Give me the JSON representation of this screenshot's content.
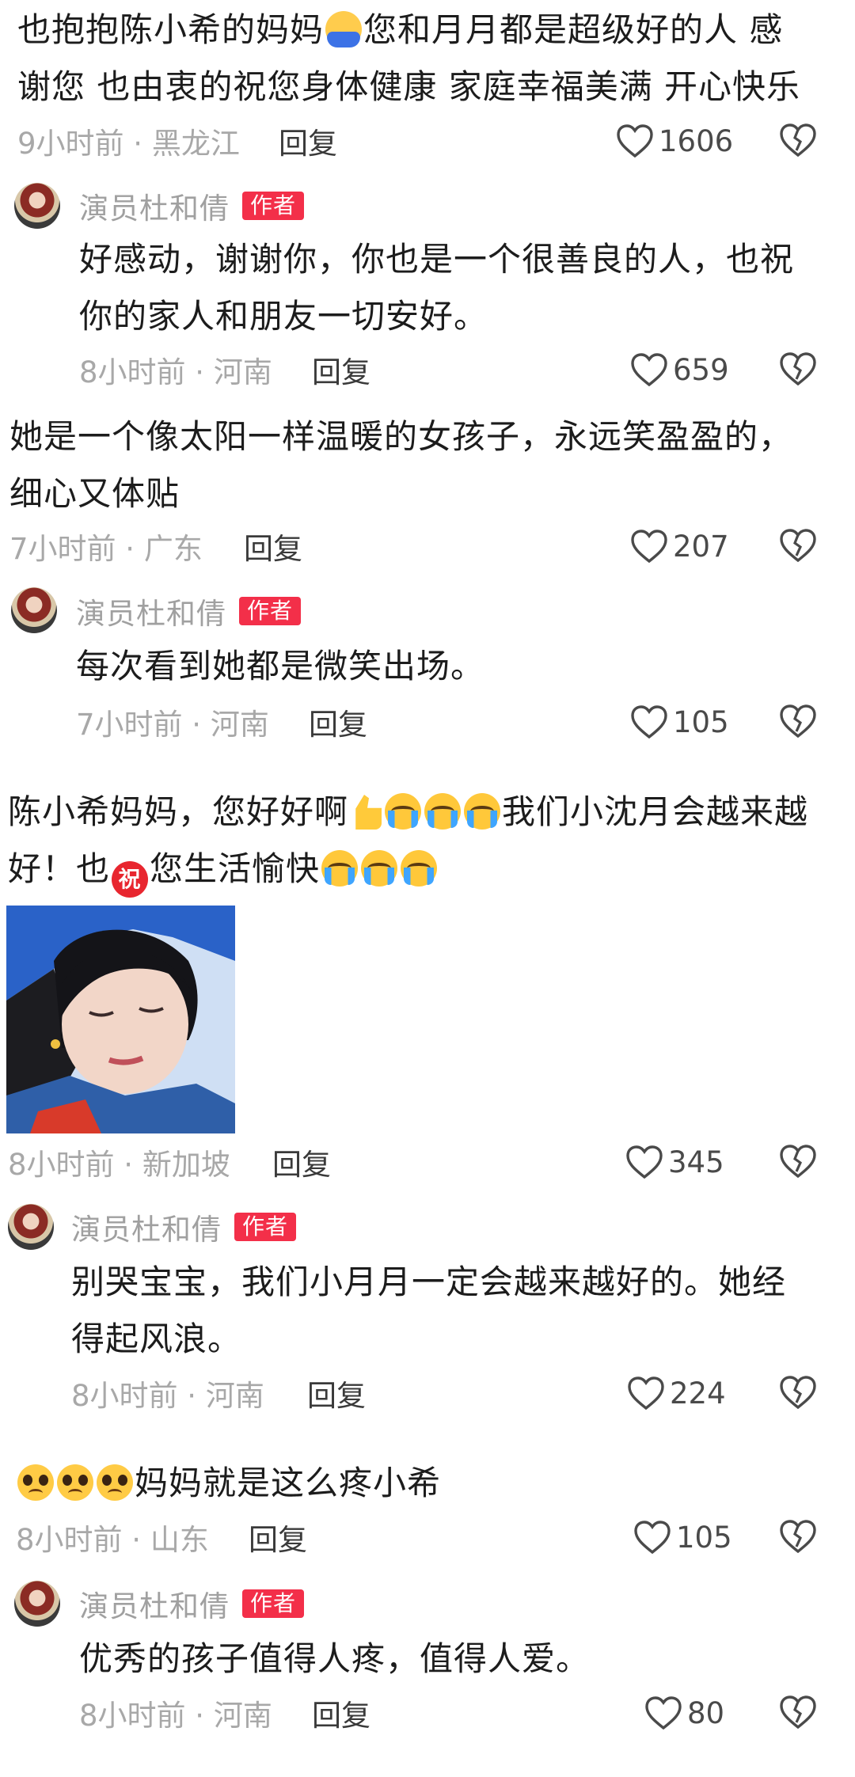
{
  "comments": [
    {
      "text": "也抱抱陈小希的妈妈",
      "text2": "您和月月都是超级好的人 感谢您 也由衷的祝您身体健康 家庭幸福美满 开心快乐",
      "time_location": "9小时前 · 黑龙江",
      "reply_label": "回复",
      "likes": "1606",
      "reply": {
        "author": "演员杜和倩",
        "badge": "作者",
        "text": "好感动，谢谢你，你也是一个很善良的人，也祝你的家人和朋友一切安好。",
        "time_location": "8小时前 · 河南",
        "reply_label": "回复",
        "likes": "659"
      }
    },
    {
      "text": "她是一个像太阳一样温暖的女孩子，永远笑盈盈的，细心又体贴",
      "time_location": "7小时前 · 广东",
      "reply_label": "回复",
      "likes": "207",
      "reply": {
        "author": "演员杜和倩",
        "badge": "作者",
        "text": "每次看到她都是微笑出场。",
        "time_location": "7小时前 · 河南",
        "reply_label": "回复",
        "likes": "105"
      }
    },
    {
      "text_a": "陈小希妈妈，您好好啊",
      "text_b": "我们小沈月会越来越好！也",
      "text_c": "您生活愉快",
      "zhu": "祝",
      "time_location": "8小时前 · 新加坡",
      "reply_label": "回复",
      "likes": "345",
      "reply": {
        "author": "演员杜和倩",
        "badge": "作者",
        "text": "别哭宝宝，我们小月月一定会越来越好的。她经得起风浪。",
        "time_location": "8小时前 · 河南",
        "reply_label": "回复",
        "likes": "224"
      }
    },
    {
      "text": "妈妈就是这么疼小希",
      "time_location": "8小时前 · 山东",
      "reply_label": "回复",
      "likes": "105",
      "reply": {
        "author": "演员杜和倩",
        "badge": "作者",
        "text": "优秀的孩子值得人疼，值得人爱。",
        "time_location": "8小时前 · 河南",
        "reply_label": "回复",
        "likes": "80"
      }
    }
  ],
  "colors": {
    "badge": "#f32f49",
    "meta": "#a8a8a8",
    "text": "#1c1c1c"
  },
  "icons": {
    "like": "heart-outline-icon",
    "dislike": "broken-heart-icon"
  }
}
